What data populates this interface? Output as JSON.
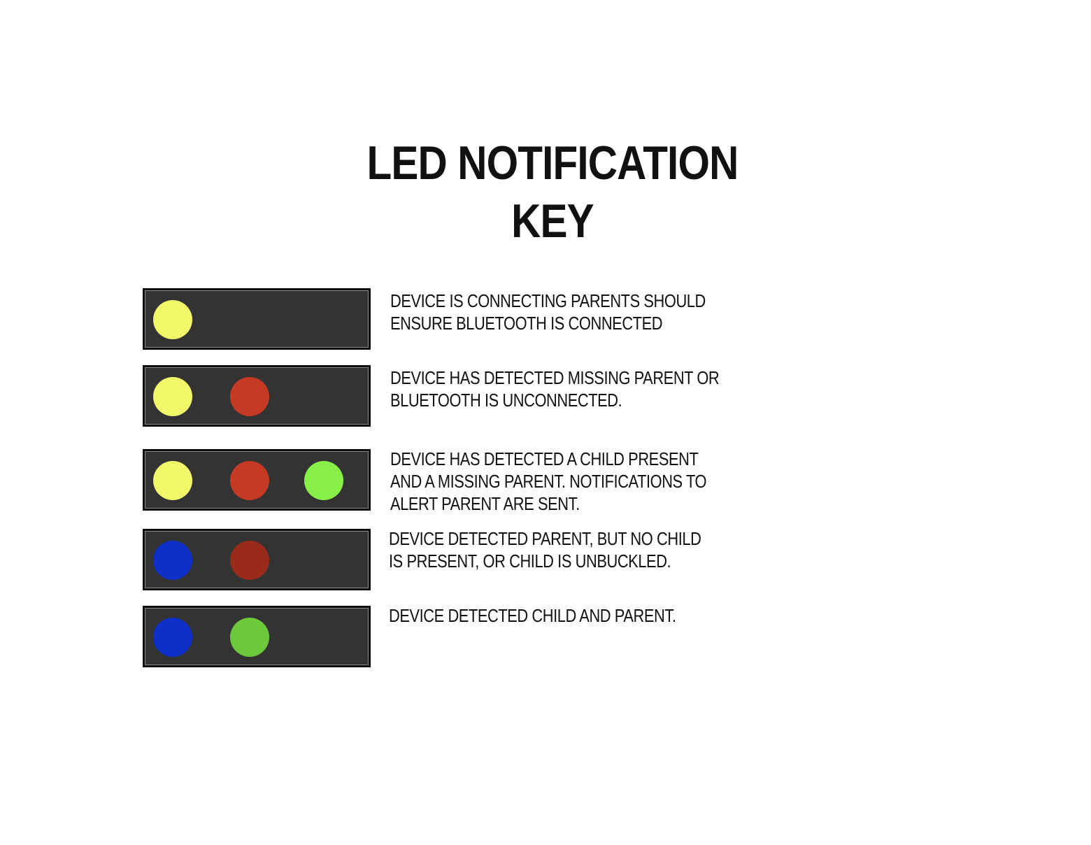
{
  "title": {
    "line1": "LED NOTIFICATION",
    "line2": "KEY"
  },
  "colors": {
    "yellow": "#f2f76a",
    "red": "#c63a24",
    "dark_red": "#9a2a1a",
    "bright_green": "#88ef48",
    "green": "#6cc93c",
    "blue": "#0f2fc9",
    "panel": "#333333"
  },
  "rows": [
    {
      "leds": [
        "yellow"
      ],
      "description": [
        "DEVICE IS CONNECTING PARENTS SHOULD",
        "ENSURE BLUETOOTH IS CONNECTED"
      ]
    },
    {
      "leds": [
        "yellow",
        "red"
      ],
      "description": [
        "DEVICE HAS DETECTED MISSING PARENT OR",
        "BLUETOOTH IS UNCONNECTED."
      ]
    },
    {
      "leds": [
        "yellow",
        "red",
        "bright_green"
      ],
      "description": [
        "DEVICE HAS DETECTED A CHILD PRESENT",
        "AND A MISSING PARENT. NOTIFICATIONS TO",
        "ALERT PARENT ARE SENT."
      ]
    },
    {
      "leds": [
        "blue",
        "dark_red"
      ],
      "description": [
        "DEVICE DETECTED PARENT, BUT NO CHILD",
        "IS PRESENT, OR CHILD IS UNBUCKLED."
      ]
    },
    {
      "leds": [
        "blue",
        "green"
      ],
      "description": [
        "DEVICE DETECTED CHILD AND PARENT."
      ]
    }
  ]
}
